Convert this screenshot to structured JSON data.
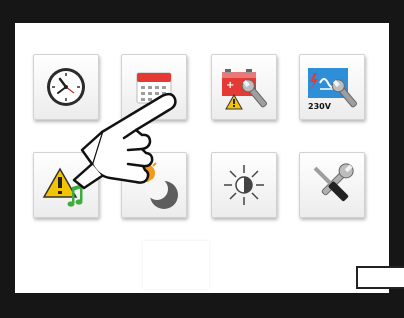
{
  "screen": {
    "tiles_row1": [
      {
        "icon": "clock-icon"
      },
      {
        "icon": "calendar-icon"
      },
      {
        "icon": "battery-warning-wrench-icon"
      },
      {
        "icon": "ac-power-wrench-icon"
      }
    ],
    "tiles_row2": [
      {
        "icon": "warning-music-icon"
      },
      {
        "icon": "sun-moon-icon"
      },
      {
        "icon": "brightness-icon"
      },
      {
        "icon": "tools-icon"
      }
    ],
    "voltage_label": "230V"
  },
  "colors": {
    "bezel": "#161616",
    "calendar_red": "#e53935",
    "warning_yellow": "#f5c400",
    "music_green": "#3faa3f",
    "power_blue": "#2e8fd8",
    "sun_orange": "#f29a1c"
  }
}
